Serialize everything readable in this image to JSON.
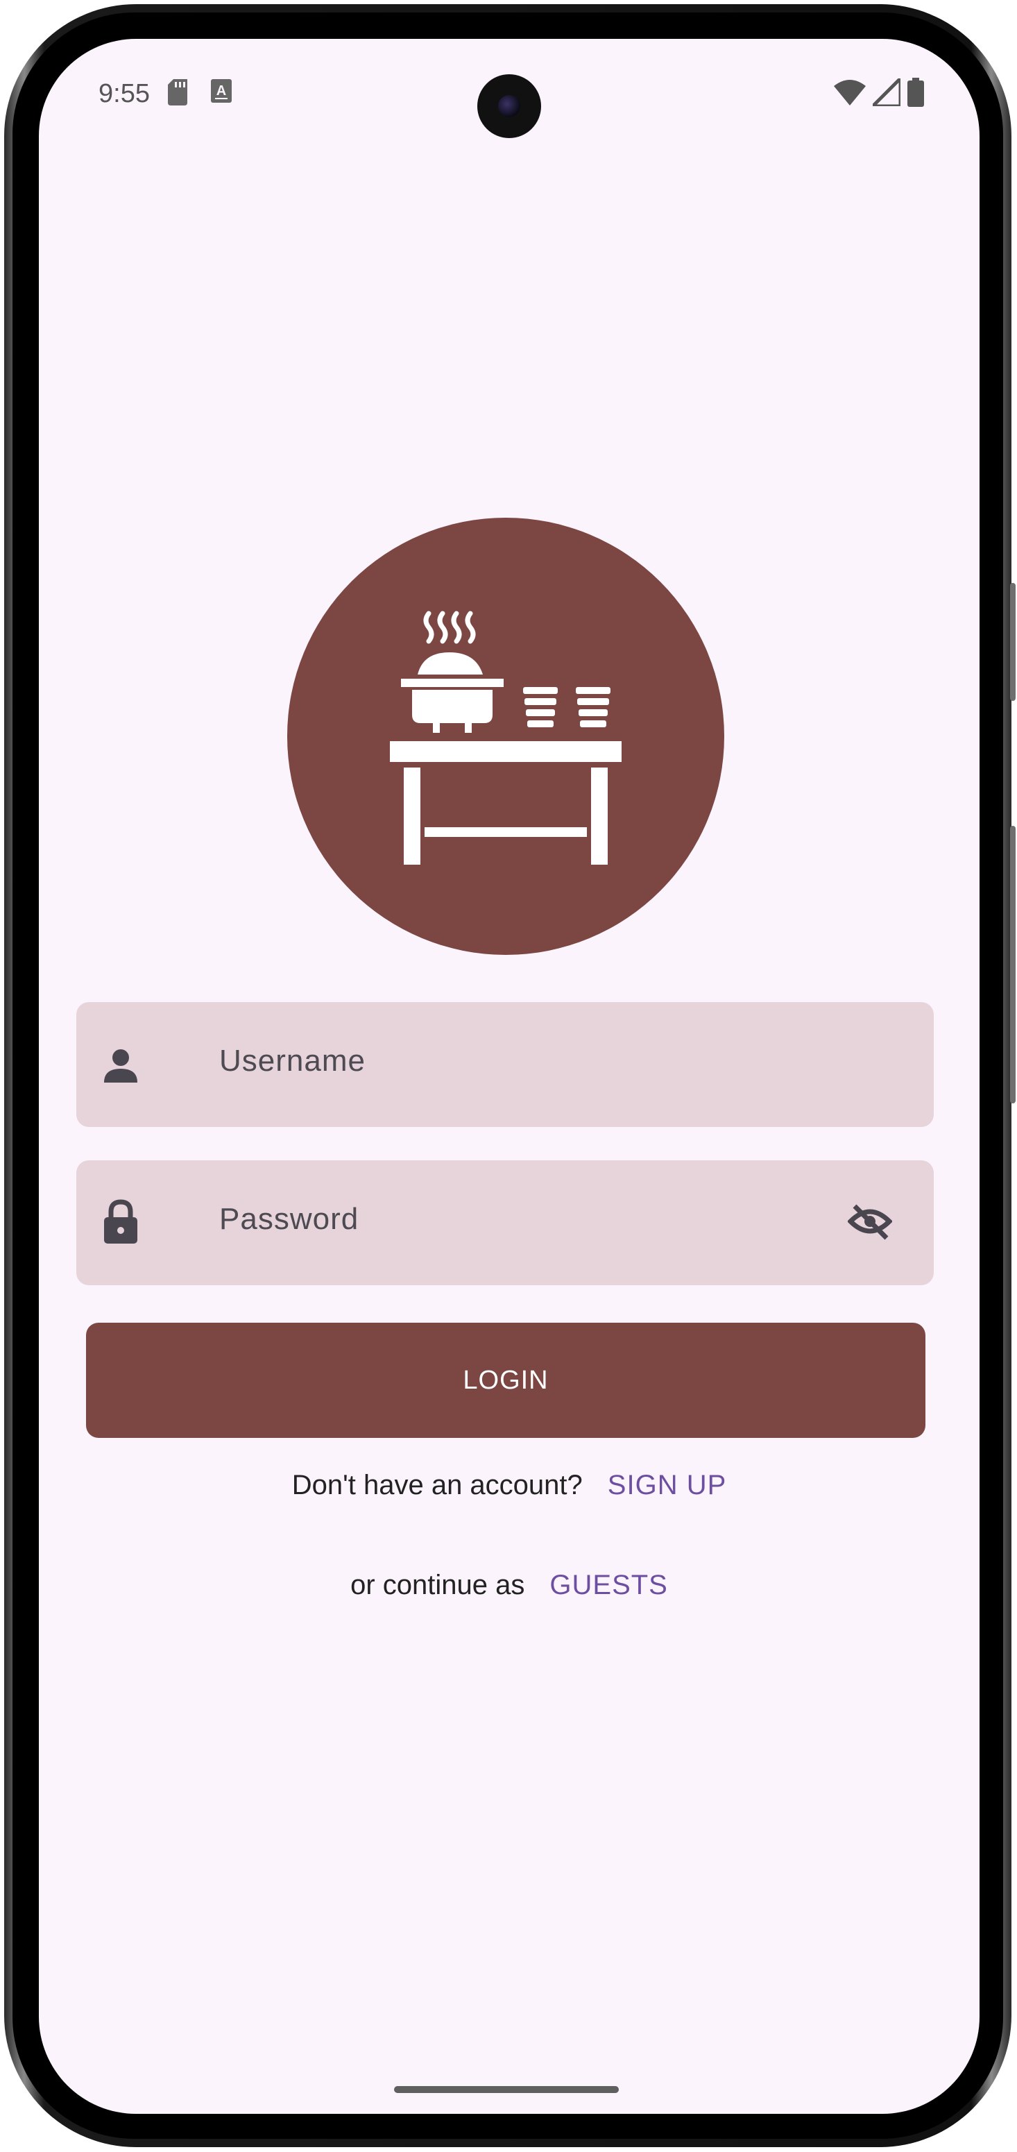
{
  "status_bar": {
    "time": "9:55",
    "icons": [
      "sd-card-icon",
      "font-a-icon",
      "wifi-icon",
      "signal-icon",
      "battery-icon"
    ]
  },
  "logo": {
    "icon": "buffet-table-icon",
    "bg_color": "#7c4643"
  },
  "form": {
    "username": {
      "placeholder": "Username",
      "icon": "person-icon"
    },
    "password": {
      "placeholder": "Password",
      "icon": "lock-icon",
      "trailing_icon": "visibility-off-icon"
    },
    "login_label": "LOGIN"
  },
  "signup_row": {
    "prompt": "Don't have an account?",
    "link": "SIGN UP"
  },
  "guest_row": {
    "prompt": "or continue as",
    "link": "GUESTS"
  },
  "colors": {
    "accent": "#7c4643",
    "link": "#6c4fa0",
    "field_bg": "#e6d4da",
    "screen_bg": "#fcf4fc"
  }
}
